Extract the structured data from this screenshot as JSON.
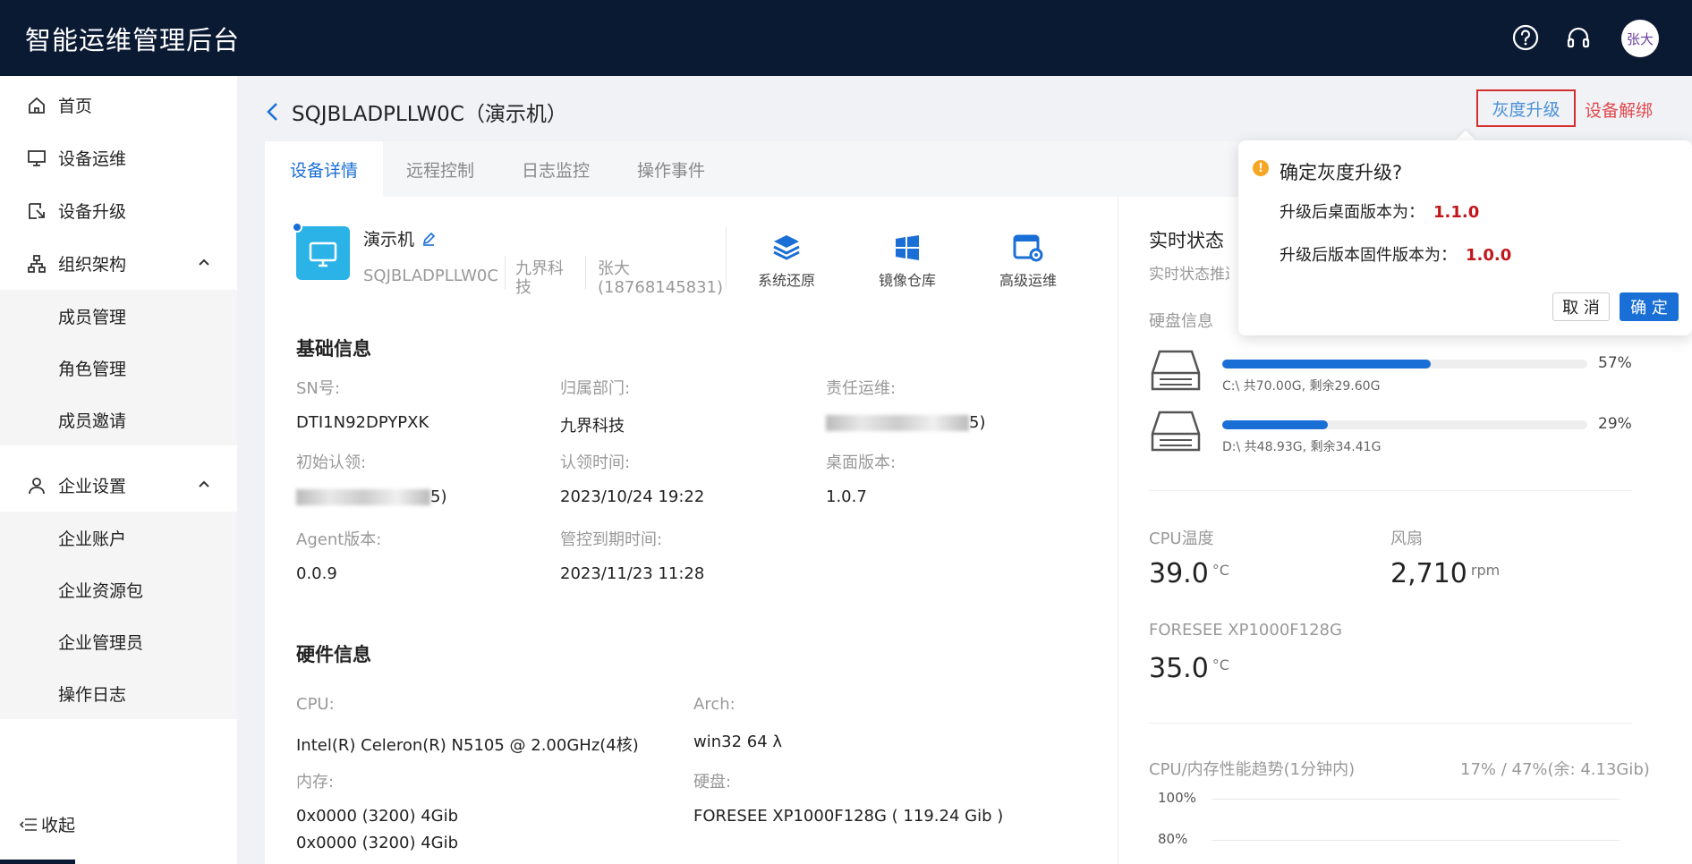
{
  "app": {
    "title": "智能运维管理后台",
    "user_avatar": "张大"
  },
  "sidebar": {
    "items": [
      {
        "label": "首页"
      },
      {
        "label": "设备运维"
      },
      {
        "label": "设备升级"
      },
      {
        "label": "组织架构"
      },
      {
        "label": "企业设置"
      }
    ],
    "org_sub": [
      {
        "label": "成员管理"
      },
      {
        "label": "角色管理"
      },
      {
        "label": "成员邀请"
      }
    ],
    "ent_sub": [
      {
        "label": "企业账户"
      },
      {
        "label": "企业资源包"
      },
      {
        "label": "企业管理员"
      },
      {
        "label": "操作日志"
      }
    ],
    "collapse_label": "收起"
  },
  "header": {
    "title": "SQJBLADPLLW0C（演示机）",
    "gray_upgrade": "灰度升级",
    "unbind": "设备解绑"
  },
  "tabs": [
    {
      "label": "设备详情"
    },
    {
      "label": "远程控制"
    },
    {
      "label": "日志监控"
    },
    {
      "label": "操作事件"
    }
  ],
  "device": {
    "name": "演示机",
    "sn": "SQJBLADPLLW0C",
    "dept_line1": "九界科",
    "dept_line2": "技",
    "owner_line1": "张大",
    "owner_line2": "(18768145831)",
    "actions": [
      {
        "label": "系统还原"
      },
      {
        "label": "镜像仓库"
      },
      {
        "label": "高级运维"
      }
    ]
  },
  "basic": {
    "title": "基础信息",
    "sn_label": "SN号:",
    "sn_value": "DTI1N92DPYPXK",
    "dept_label": "归属部门:",
    "dept_value": "九界科技",
    "ops_label": "责任运维:",
    "ops_value_suffix": "5)",
    "first_label": "初始认领:",
    "first_value_suffix": "5)",
    "claim_label": "认领时间:",
    "claim_value": "2023/10/24 19:22",
    "desktop_label": "桌面版本:",
    "desktop_value": "1.0.7",
    "agent_label": "Agent版本:",
    "agent_value": "0.0.9",
    "expire_label": "管控到期时间:",
    "expire_value": "2023/11/23 11:28"
  },
  "hardware": {
    "title": "硬件信息",
    "cpu_label": "CPU:",
    "cpu_value": "Intel(R) Celeron(R) N5105 @ 2.00GHz(4核)",
    "arch_label": "Arch:",
    "arch_value": "win32 64 λ",
    "mem_label": "内存:",
    "mem_value_1": "0x0000 (3200) 4Gib",
    "mem_value_2": "0x0000 (3200) 4Gib",
    "disk_label": "硬盘:",
    "disk_value": "FORESEE XP1000F128G ( 119.24 Gib )"
  },
  "realtime": {
    "title": "实时状态",
    "subtitle": "实时状态推送",
    "disk_title": "硬盘信息",
    "disks": [
      {
        "percent_label": "57%",
        "percent": 57,
        "info": "C:\\ 共70.00G, 剩余29.60G"
      },
      {
        "percent_label": "29%",
        "percent": 29,
        "info": "D:\\ 共48.93G, 剩余34.41G"
      }
    ],
    "cpu_temp_label": "CPU温度",
    "cpu_temp_value": "39.0",
    "cpu_temp_unit": "°C",
    "fan_label": "风扇",
    "fan_value": "2,710",
    "fan_unit": "rpm",
    "ssd_label": "FORESEE XP1000F128G",
    "ssd_temp_value": "35.0",
    "ssd_temp_unit": "°C",
    "trend_label": "CPU/内存性能趋势(1分钟内)",
    "trend_value": "17% / 47%(余: 4.13Gib)",
    "axis_100": "100%",
    "axis_80": "80%"
  },
  "popover": {
    "title": "确定灰度升级?",
    "desktop_label": "升级后桌面版本为：",
    "desktop_value": "1.1.0",
    "firmware_label": "升级后版本固件版本为：",
    "firmware_value": "1.0.0",
    "cancel": "取 消",
    "ok": "确 定"
  },
  "colors": {
    "topbar": "#0b1a33",
    "accent": "#1a6fd6",
    "danger": "#e0494e",
    "highlight": "#c0161c"
  }
}
